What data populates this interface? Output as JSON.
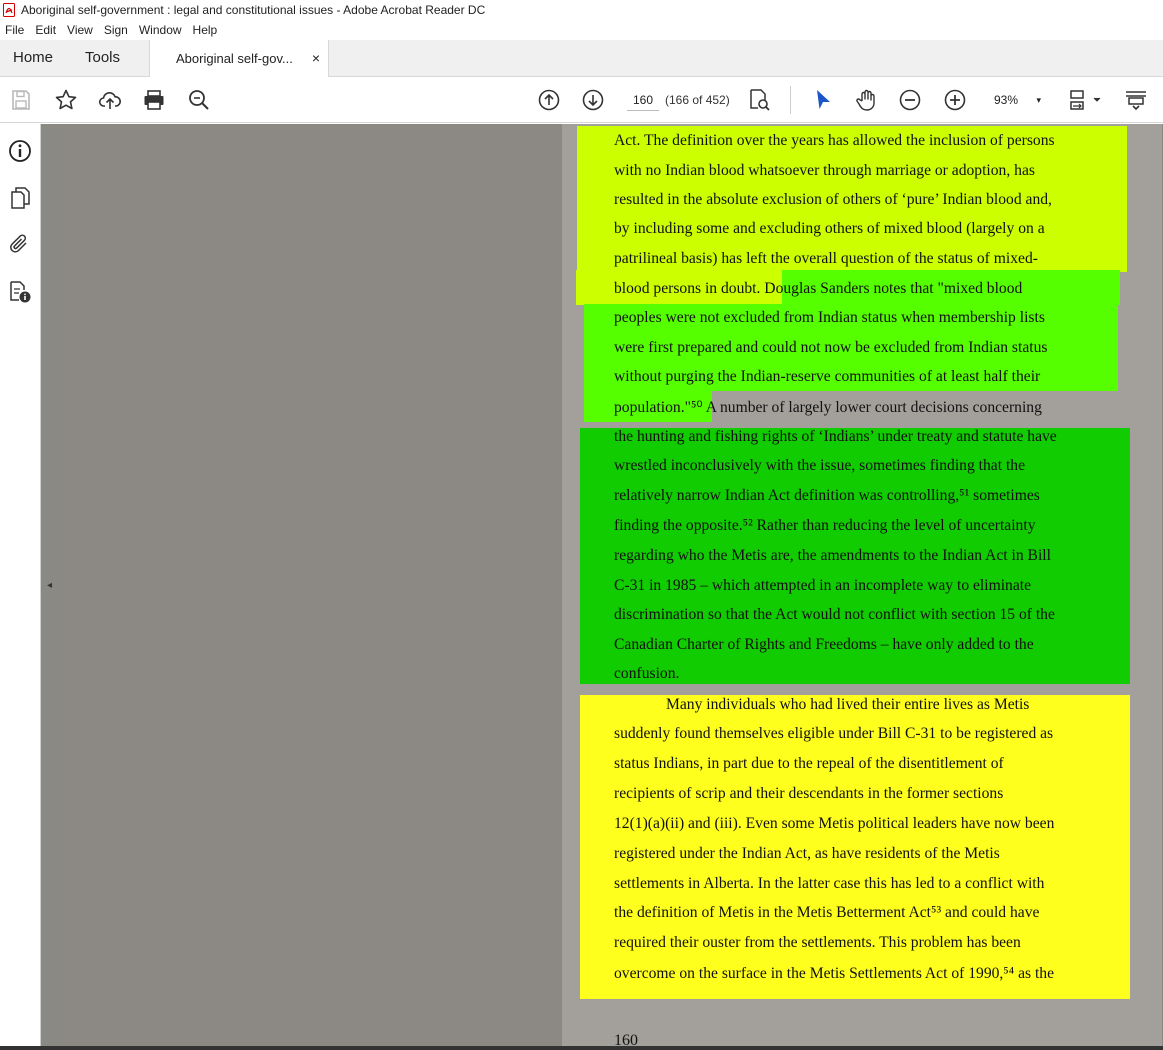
{
  "window": {
    "title": "Aboriginal self-government : legal and constitutional issues - Adobe Acrobat Reader DC"
  },
  "menu": [
    "File",
    "Edit",
    "View",
    "Sign",
    "Window",
    "Help"
  ],
  "tabs": {
    "home": "Home",
    "tools": "Tools",
    "document": "Aboriginal self-gov...",
    "close": "×"
  },
  "toolbar": {
    "page_current": "160",
    "page_count": "(166 of 452)",
    "zoom": "93%",
    "zoom_chevron": "▾",
    "icons": [
      "save-icon",
      "bookmark-star-icon",
      "upload-cloud-icon",
      "print-icon",
      "search-zoom-icon",
      "page-up-icon",
      "page-down-icon",
      "page-search-icon",
      "select-arrow-icon",
      "hand-icon",
      "zoom-out-icon",
      "zoom-in-icon",
      "page-fit-icon",
      "scroll-mode-icon"
    ]
  },
  "left_rail": {
    "icons": [
      "info-icon",
      "pages-icon",
      "attachment-icon",
      "document-properties-icon"
    ],
    "collapse": "◂"
  },
  "document": {
    "page_number": "160",
    "lines": [
      "Act. The definition over the years has allowed the inclusion of persons",
      "with no Indian blood whatsoever through marriage or adoption, has",
      "resulted in the absolute exclusion of others of ‘pure’ Indian blood and,",
      "by including some and excluding others of mixed blood (largely on a",
      "patrilineal basis) has left the overall question of the status of mixed-",
      "blood persons in doubt. Douglas Sanders notes that \"mixed blood",
      "peoples were not excluded from Indian status when membership lists",
      "were first prepared and could not now be excluded from Indian status",
      "without purging the Indian-reserve communities of at least half their",
      "population.\"⁵⁰ A number of largely lower court decisions concerning",
      "the hunting and fishing rights of ‘Indians’ under treaty and statute have",
      "wrestled inconclusively with the issue, sometimes finding that the",
      "relatively narrow Indian Act definition was controlling,⁵¹ sometimes",
      "finding the opposite.⁵² Rather than reducing the level of uncertainty",
      "regarding who the Metis are, the amendments to the Indian Act in Bill",
      "C-31 in 1985 – which attempted in an incomplete way to eliminate",
      "discrimination so that the Act would not conflict with section 15 of the",
      "Canadian Charter of Rights and Freedoms – have only added to the",
      "confusion.",
      "Many individuals who had lived their entire lives as Metis",
      "suddenly found themselves eligible under Bill C-31 to be registered as",
      "status Indians, in part due to the repeal of the disentitlement of",
      "recipients of scrip and their descendants in the former sections",
      "12(1)(a)(ii) and (iii). Even some Metis political leaders have now been",
      "registered under the Indian Act, as have residents of the Metis",
      "settlements in Alberta. In the latter case this has led to a conflict with",
      "the definition of Metis in the Metis Betterment Act⁵³ and could have",
      "required their ouster from the settlements. This problem has been",
      "overcome on the surface in the Metis Settlements Act of 1990,⁵⁴ as the"
    ]
  },
  "colors": {
    "highlight_lime": "#ccff00",
    "highlight_green": "#55ff00",
    "highlight_dark_green": "#11cc00",
    "highlight_yellow": "#ffff1e",
    "canvas_gray": "#8b8984",
    "select_blue": "#1a56c9"
  }
}
